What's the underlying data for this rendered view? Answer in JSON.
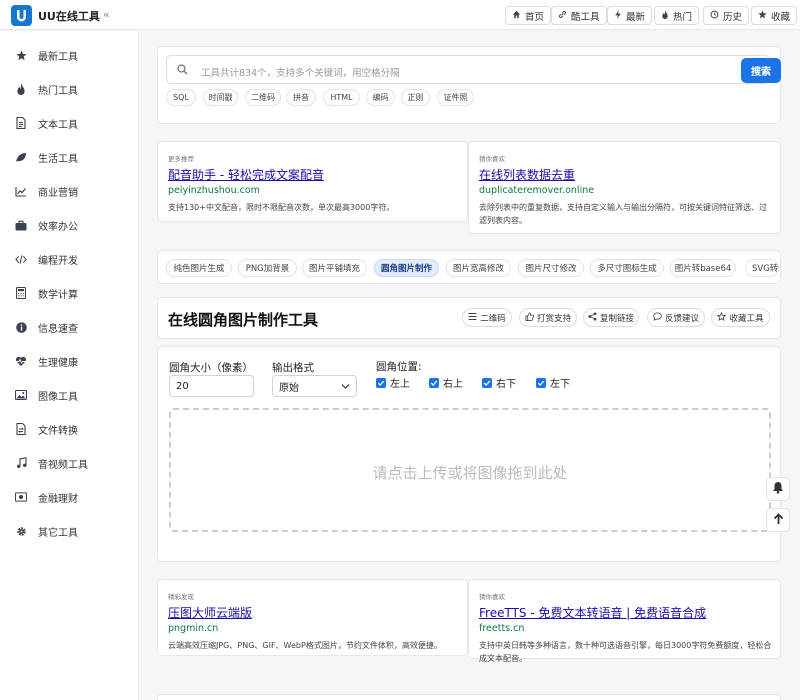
{
  "app": {
    "title": "UU在线工具",
    "collapse": "«"
  },
  "topnav": [
    {
      "label": "首页",
      "icon": "home-icon"
    },
    {
      "label": "酷工具",
      "icon": "link-icon"
    },
    {
      "label": "最新",
      "icon": "bolt-icon"
    },
    {
      "label": "热门",
      "icon": "fire-icon"
    },
    {
      "label": "历史",
      "icon": "history-icon"
    },
    {
      "label": "收藏",
      "icon": "star-icon"
    }
  ],
  "sidebar": {
    "items": [
      {
        "label": "最新工具",
        "icon": "star-icon"
      },
      {
        "label": "热门工具",
        "icon": "fire-icon"
      },
      {
        "label": "文本工具",
        "icon": "document-icon"
      },
      {
        "label": "生活工具",
        "icon": "leaf-icon"
      },
      {
        "label": "商业营销",
        "icon": "chart-line-icon"
      },
      {
        "label": "效率办公",
        "icon": "briefcase-icon"
      },
      {
        "label": "编程开发",
        "icon": "code-icon"
      },
      {
        "label": "数学计算",
        "icon": "calculator-icon"
      },
      {
        "label": "信息速查",
        "icon": "info-icon"
      },
      {
        "label": "生理健康",
        "icon": "heartbeat-icon"
      },
      {
        "label": "图像工具",
        "icon": "image-icon"
      },
      {
        "label": "文件转换",
        "icon": "file-convert-icon"
      },
      {
        "label": "音视频工具",
        "icon": "music-icon"
      },
      {
        "label": "金融理财",
        "icon": "money-icon"
      },
      {
        "label": "其它工具",
        "icon": "gear-icon"
      }
    ]
  },
  "search": {
    "placeholder": "工具共计834个，支持多个关键词，用空格分隔",
    "button": "搜索",
    "tags": [
      "SQL",
      "时间戳",
      "二维码",
      "拼音",
      "HTML",
      "编码",
      "正则",
      "证件照"
    ]
  },
  "ads_top": [
    {
      "small": "更多推荐",
      "title": "配音助手 - 轻松完成文案配音",
      "url": "peiyinzhushou.com",
      "desc": "支持130+中文配音，限时不限配音次数，单次最高3000字符。"
    },
    {
      "small": "猜你喜欢",
      "title": "在线列表数据去重",
      "url": "duplicateremover.online",
      "desc": "去除列表中的重复数据，支持自定义输入与输出分隔符，可按关键词特征筛选、过滤列表内容。"
    }
  ],
  "related_tabs": [
    "纯色图片生成",
    "PNG加背景",
    "图片平铺填充",
    "圆角图片制作",
    "图片宽高修改",
    "图片尺寸修改",
    "多尺寸图标生成",
    "图片转base64",
    "SVG转"
  ],
  "active_tab": "圆角图片制作",
  "tool": {
    "title": "在线圆角图片制作工具",
    "actions": [
      {
        "label": "二维码",
        "icon": "qrcode-icon"
      },
      {
        "label": "打赏支持",
        "icon": "thumbs-up-icon"
      },
      {
        "label": "复制链接",
        "icon": "share-icon"
      },
      {
        "label": "反馈建议",
        "icon": "comment-icon"
      },
      {
        "label": "收藏工具",
        "icon": "star-outline-icon"
      }
    ]
  },
  "form": {
    "radius_label": "圆角大小（像素）",
    "radius_value": "20",
    "format_label": "输出格式",
    "format_value": "原始",
    "position_label": "圆角位置:",
    "positions": [
      {
        "label": "左上",
        "checked": true
      },
      {
        "label": "右上",
        "checked": true
      },
      {
        "label": "右下",
        "checked": true
      },
      {
        "label": "左下",
        "checked": true
      }
    ],
    "drop_text": "请点击上传或将图像拖到此处"
  },
  "ads_bottom": [
    {
      "small": "精彩发现",
      "title": "压图大师云端版",
      "url": "pngmin.cn",
      "desc": "云端高效压缩JPG、PNG、GIF、WebP格式图片，节约文件体积，高效便捷。"
    },
    {
      "small": "猜你喜欢",
      "title": "FreeTTS - 免费文本转语音 | 免费语音合成",
      "url": "freetts.cn",
      "desc": "支持中英日韩等多种语言，数十种可选语音引擎，每日3000字符免费额度，轻松合成文本配音。"
    }
  ],
  "colors": {
    "accent": "#1b73e8",
    "link": "#1a0dab",
    "url": "#0c7a3e"
  }
}
